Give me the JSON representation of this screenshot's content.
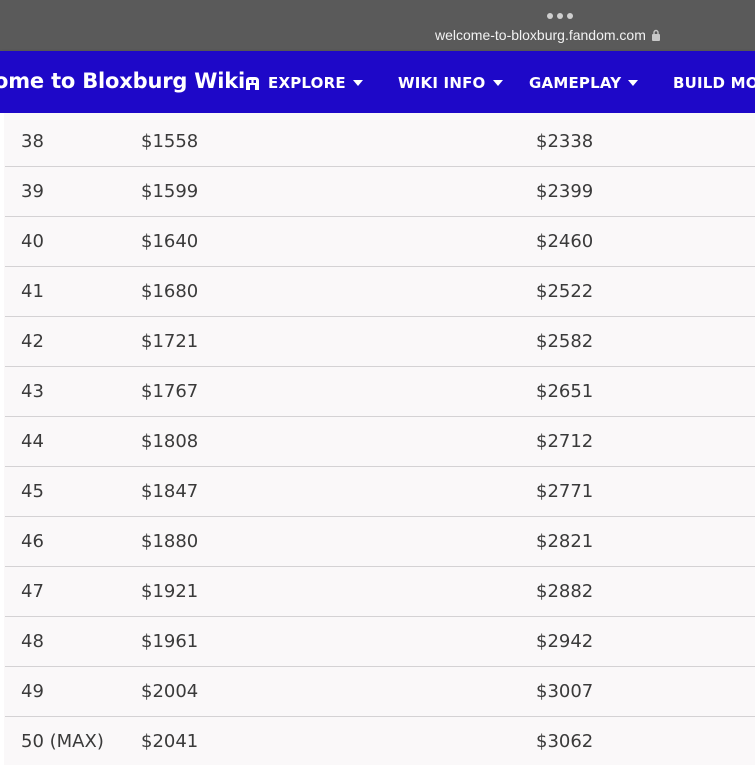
{
  "browser": {
    "url": "welcome-to-bloxburg.fandom.com"
  },
  "navbar": {
    "site_title": "ome to Bloxburg Wiki",
    "items": [
      {
        "label": "EXPLORE",
        "icon": "explore-icon"
      },
      {
        "label": "WIKI INFO"
      },
      {
        "label": "GAMEPLAY"
      },
      {
        "label": "BUILD MO"
      }
    ]
  },
  "colors": {
    "navbar": "#1e08c8",
    "browser_bar": "#5a5a5a",
    "background": "#faf8f9"
  },
  "table": {
    "rows": [
      {
        "level": "38",
        "a": "$1558",
        "b": "$2338"
      },
      {
        "level": "39",
        "a": "$1599",
        "b": "$2399"
      },
      {
        "level": "40",
        "a": "$1640",
        "b": "$2460"
      },
      {
        "level": "41",
        "a": "$1680",
        "b": "$2522"
      },
      {
        "level": "42",
        "a": "$1721",
        "b": "$2582"
      },
      {
        "level": "43",
        "a": "$1767",
        "b": "$2651"
      },
      {
        "level": "44",
        "a": "$1808",
        "b": "$2712"
      },
      {
        "level": "45",
        "a": "$1847",
        "b": "$2771"
      },
      {
        "level": "46",
        "a": "$1880",
        "b": "$2821"
      },
      {
        "level": "47",
        "a": "$1921",
        "b": "$2882"
      },
      {
        "level": "48",
        "a": "$1961",
        "b": "$2942"
      },
      {
        "level": "49",
        "a": "$2004",
        "b": "$3007"
      },
      {
        "level": "50 (MAX)",
        "a": "$2041",
        "b": "$3062"
      }
    ]
  }
}
